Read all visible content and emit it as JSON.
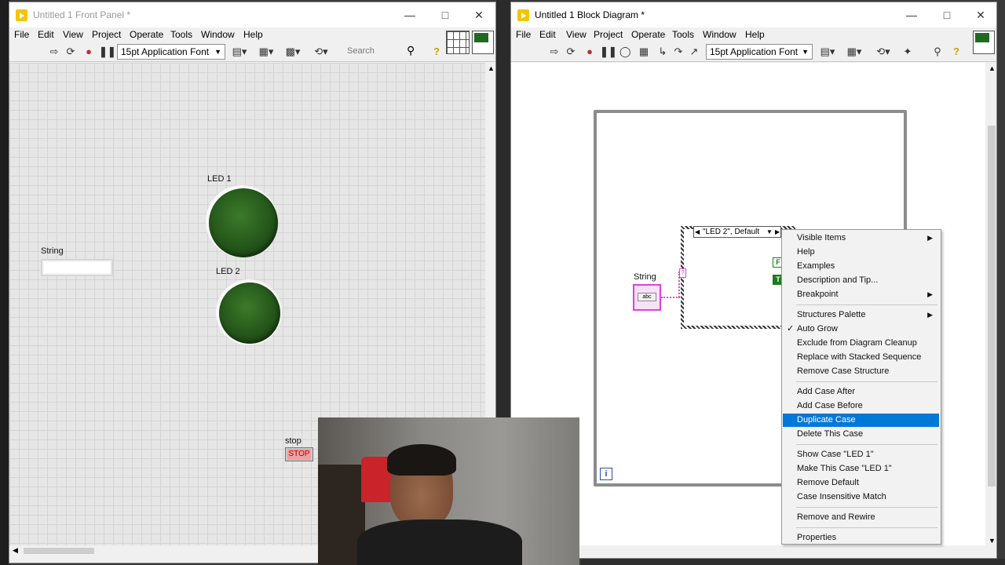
{
  "front_panel": {
    "title": "Untitled 1 Front Panel *",
    "menu": [
      "File",
      "Edit",
      "View",
      "Project",
      "Operate",
      "Tools",
      "Window",
      "Help"
    ],
    "font_select": "15pt Application Font",
    "search_placeholder": "Search",
    "string_label": "String",
    "led1_label": "LED 1",
    "led2_label": "LED 2",
    "stop_label": "stop",
    "stop_button": "STOP"
  },
  "block_diagram": {
    "title": "Untitled 1 Block Diagram *",
    "menu": [
      "File",
      "Edit",
      "View",
      "Project",
      "Operate",
      "Tools",
      "Window",
      "Help"
    ],
    "font_select": "15pt Application Font",
    "case_selector": "\"LED 2\", Default",
    "string_label": "String",
    "string_terminal": "abc",
    "false_const": "F",
    "true_const": "T",
    "iteration_terminal": "i"
  },
  "context_menu": {
    "groups": [
      [
        {
          "label": "Visible Items",
          "submenu": true
        },
        {
          "label": "Help"
        },
        {
          "label": "Examples"
        },
        {
          "label": "Description and Tip..."
        },
        {
          "label": "Breakpoint",
          "submenu": true
        }
      ],
      [
        {
          "label": "Structures Palette",
          "submenu": true
        },
        {
          "label": "Auto Grow",
          "checked": true
        },
        {
          "label": "Exclude from Diagram Cleanup"
        },
        {
          "label": "Replace with Stacked Sequence"
        },
        {
          "label": "Remove Case Structure"
        }
      ],
      [
        {
          "label": "Add Case After"
        },
        {
          "label": "Add Case Before"
        },
        {
          "label": "Duplicate Case",
          "highlighted": true
        },
        {
          "label": "Delete This Case"
        }
      ],
      [
        {
          "label": "Show Case \"LED 1\""
        },
        {
          "label": "Make This Case \"LED 1\""
        },
        {
          "label": "Remove Default"
        },
        {
          "label": "Case Insensitive Match"
        }
      ],
      [
        {
          "label": "Remove and Rewire"
        }
      ],
      [
        {
          "label": "Properties"
        }
      ]
    ]
  },
  "colors": {
    "highlight": "#0078d7",
    "led_green": "#24561a",
    "string_wire": "#e040e0",
    "window_bg": "#f0f0f0"
  }
}
